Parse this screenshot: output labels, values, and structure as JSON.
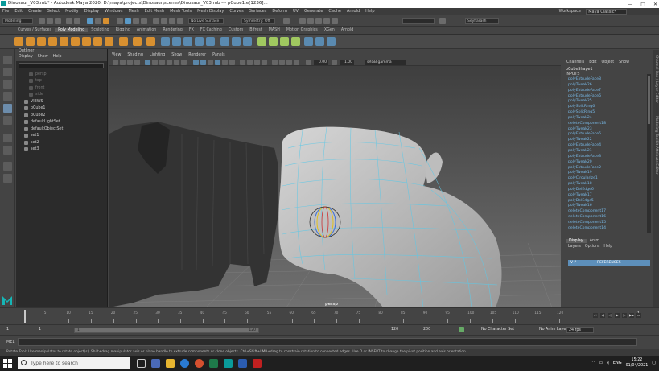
{
  "window": {
    "title": "Dinosaur_V03.mb* - Autodesk Maya 2020: D:\\maya\\projects\\Dinosaur\\scenes\\Dinosaur_V03.mb  ---  pCube1.e[1236]...",
    "min_glyph": "—",
    "max_glyph": "□",
    "close_glyph": "✕"
  },
  "menubar": {
    "items": [
      "File",
      "Edit",
      "Create",
      "Select",
      "Modify",
      "Display",
      "Windows",
      "Mesh",
      "Edit Mesh",
      "Mesh Tools",
      "Mesh Display",
      "Curves",
      "Surfaces",
      "Deform",
      "UV",
      "Generate",
      "Cache",
      "Arnold",
      "Help"
    ],
    "workspace_label": "Workspace :",
    "workspace_value": "Maya Classic*"
  },
  "statusline": {
    "mode": "Modeling",
    "live_surface": "No Live Surface",
    "symmetry": "Symmetry: Off",
    "user": "Seyf.arash"
  },
  "shelf_tabs": {
    "items": [
      "Curves / Surfaces",
      "Poly Modeling",
      "Sculpting",
      "Rigging",
      "Animation",
      "Rendering",
      "FX",
      "FX Caching",
      "Custom",
      "Bifrost",
      "MASH",
      "Motion Graphics",
      "XGen",
      "Arnold"
    ],
    "active_index": 1
  },
  "outliner": {
    "title": "Outliner",
    "menu": [
      "Display",
      "Show",
      "Help"
    ],
    "items": [
      {
        "label": "persp",
        "dim": true,
        "indent": 1
      },
      {
        "label": "top",
        "dim": true,
        "indent": 1
      },
      {
        "label": "front",
        "dim": true,
        "indent": 1
      },
      {
        "label": "side",
        "dim": true,
        "indent": 1
      },
      {
        "label": "VIEWS",
        "dim": false,
        "indent": 0
      },
      {
        "label": "pCube1",
        "dim": false,
        "indent": 0
      },
      {
        "label": "pCube2",
        "dim": false,
        "indent": 0
      },
      {
        "label": "defaultLightSet",
        "dim": false,
        "indent": 0
      },
      {
        "label": "defaultObjectSet",
        "dim": false,
        "indent": 0
      },
      {
        "label": "set1",
        "dim": false,
        "indent": 0
      },
      {
        "label": "set2",
        "dim": false,
        "indent": 0
      },
      {
        "label": "set3",
        "dim": false,
        "indent": 0
      }
    ]
  },
  "viewport": {
    "menu": [
      "View",
      "Shading",
      "Lighting",
      "Show",
      "Renderer",
      "Panels"
    ],
    "value1": "0.00",
    "value2": "1.00",
    "color_space": "sRGB gamma",
    "camera_label": "persp"
  },
  "channelbox": {
    "menu": [
      "Channels",
      "Edit",
      "Object",
      "Show"
    ],
    "object": "pCubeShape1",
    "inputs_label": "INPUTS",
    "history": [
      "polyExtrudeFace8",
      "polyTweak26",
      "polyExtrudeFace7",
      "polyExtrudeFace6",
      "polyTweak25",
      "polySplitRing6",
      "polySplitRing5",
      "polyTweak24",
      "deleteComponent18",
      "polyTweak23",
      "polyExtrudeFace5",
      "polyTweak22",
      "polyExtrudeFace4",
      "polyTweak21",
      "polyExtrudeFace3",
      "polyTweak20",
      "polyExtrudeFace2",
      "polyTweak19",
      "polyCircularize1",
      "polyTweak18",
      "polyDelEdge6",
      "polyTweak17",
      "polyDelEdge5",
      "polyTweak16",
      "deleteComponent17",
      "deleteComponent16",
      "deleteComponent15",
      "deleteComponent14"
    ]
  },
  "side_tabs": [
    "Channel Box / Layer Editor",
    "Modeling Toolkit",
    "Attribute Editor"
  ],
  "layer_editor": {
    "tabs": [
      "Display",
      "Anim"
    ],
    "menu": [
      "Layers",
      "Options",
      "Help"
    ],
    "layer_flags": "V P",
    "layer_name": "REFERENCES"
  },
  "timeslider": {
    "ticks": [
      "5",
      "10",
      "15",
      "20",
      "25",
      "30",
      "35",
      "40",
      "45",
      "50",
      "55",
      "60",
      "65",
      "70",
      "75",
      "80",
      "85",
      "90",
      "95",
      "100",
      "105",
      "110",
      "115",
      "120"
    ],
    "current_frame": "1",
    "playback_glyphs": [
      "⏮",
      "◀",
      "◁",
      "▶",
      "▷",
      "▶▶",
      "⏭"
    ]
  },
  "rangeslider": {
    "start": "1",
    "start2": "1",
    "range_start": "1",
    "range_end": "120",
    "end": "120",
    "end2": "200",
    "character_set": "No Character Set",
    "anim_layer": "No Anim Layer",
    "fps": "24 fps"
  },
  "mel": {
    "label": "MEL"
  },
  "helpline": "Rotate Tool: Use manipulator to rotate object(s). Shift+drag manipulator axis or plane handle to extrude components or clone objects. Ctrl+Shift+LMB+drag to constrain rotation to connected edges. Use D or INSERT to change the pivot position and axis orientation.",
  "taskbar": {
    "search_placeholder": "Type here to search",
    "lang": "ENG",
    "time": "15:22",
    "date": "01/04/2021"
  },
  "colors": {
    "accent": "#5d8fba",
    "history_text": "#77b8e6",
    "wireframe": "#5ec8e6"
  }
}
